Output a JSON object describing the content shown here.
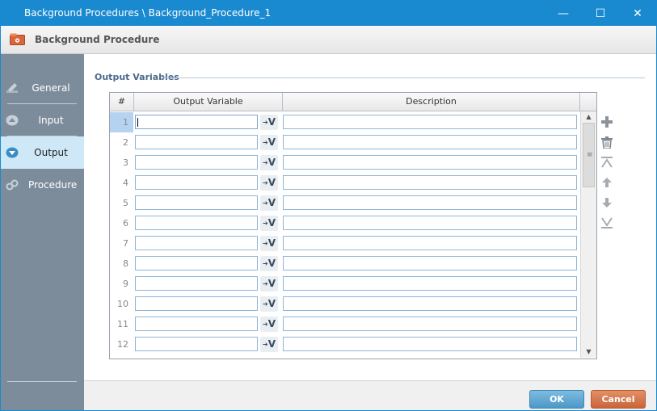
{
  "window": {
    "title": "Background Procedures \\ Background_Procedure_1",
    "minimize": "—",
    "maximize": "☐",
    "close": "✕"
  },
  "header": {
    "title": "Background Procedure"
  },
  "sidebar": {
    "items": [
      {
        "label": "General",
        "icon": "pencil-icon",
        "active": false
      },
      {
        "label": "Input",
        "icon": "arrow-up-circle-icon",
        "active": false
      },
      {
        "label": "Output",
        "icon": "arrow-down-circle-icon",
        "active": true
      },
      {
        "label": "Procedure",
        "icon": "gear-chain-icon",
        "active": false
      }
    ]
  },
  "section": {
    "title": "Output Variables"
  },
  "table": {
    "columns": [
      "#",
      "Output Variable",
      "Description"
    ],
    "rows": [
      {
        "num": "1",
        "var": "",
        "desc": ""
      },
      {
        "num": "2",
        "var": "",
        "desc": ""
      },
      {
        "num": "3",
        "var": "",
        "desc": ""
      },
      {
        "num": "4",
        "var": "",
        "desc": ""
      },
      {
        "num": "5",
        "var": "",
        "desc": ""
      },
      {
        "num": "6",
        "var": "",
        "desc": ""
      },
      {
        "num": "7",
        "var": "",
        "desc": ""
      },
      {
        "num": "8",
        "var": "",
        "desc": ""
      },
      {
        "num": "9",
        "var": "",
        "desc": ""
      },
      {
        "num": "10",
        "var": "",
        "desc": ""
      },
      {
        "num": "11",
        "var": "",
        "desc": ""
      },
      {
        "num": "12",
        "var": "",
        "desc": ""
      }
    ],
    "var_button_label": "V"
  },
  "toolbar": {
    "add": "add-icon",
    "delete": "trash-icon",
    "move_top": "move-top-icon",
    "move_up": "move-up-icon",
    "move_down": "move-down-icon",
    "move_bottom": "move-bottom-icon"
  },
  "buttons": {
    "ok": "OK",
    "cancel": "Cancel"
  },
  "colors": {
    "titlebar": "#1a8ad0",
    "sidebar": "#7d8c9b",
    "active": "#cfe8f7",
    "ok": "#4c98c8",
    "cancel": "#c9643a"
  }
}
